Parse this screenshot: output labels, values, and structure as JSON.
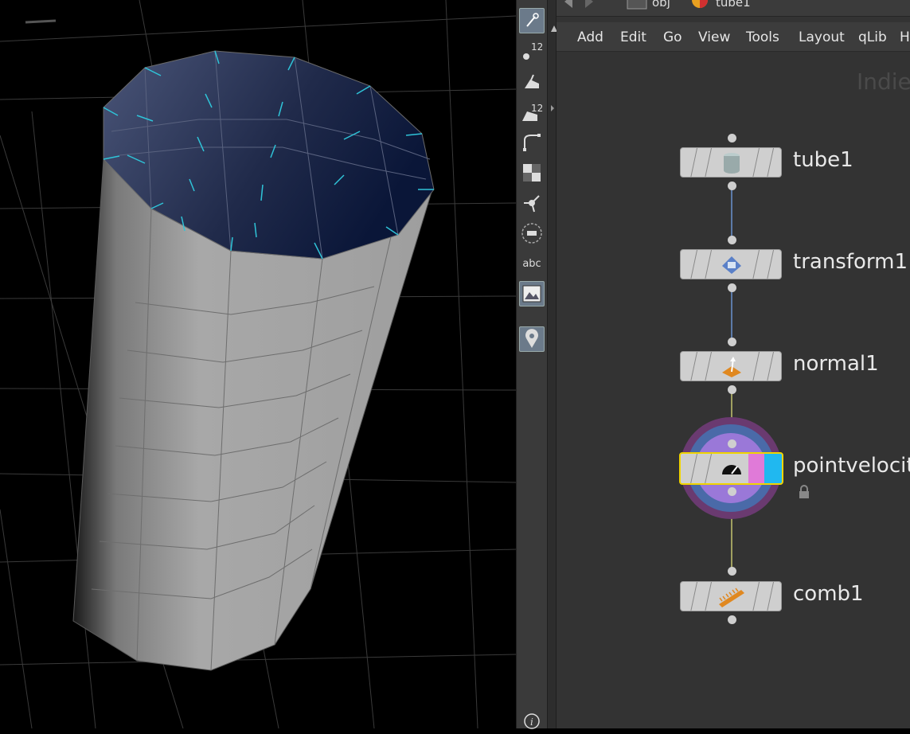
{
  "pathbar": {
    "context": "obj",
    "node": "tube1"
  },
  "menu": [
    "Add",
    "Edit",
    "Go",
    "View",
    "Tools",
    "Layout",
    "qLib",
    "H"
  ],
  "watermark": "Indie",
  "toolbar": {
    "items": [
      "select-tool",
      "point-count-tool",
      "paint-tool",
      "stamp-count-tool",
      "curve-tool",
      "checker-tool",
      "pivot-tool",
      "circle-tool",
      "text-tool",
      "image-tool",
      "pin-tool",
      "info-tool"
    ],
    "count_a": "12",
    "count_b": "12",
    "text_label": "abc"
  },
  "nodes": [
    {
      "name": "tube1",
      "icon": "tube-icon"
    },
    {
      "name": "transform1",
      "icon": "transform-icon"
    },
    {
      "name": "normal1",
      "icon": "normal-icon"
    },
    {
      "name": "pointvelocit",
      "icon": "speedometer-icon",
      "selected": true,
      "locked": true
    },
    {
      "name": "comb1",
      "icon": "comb-icon"
    }
  ],
  "colors": {
    "selected_outline": "#f0d400",
    "display_flag": "#e07ad8",
    "render_flag": "#20b8f0",
    "wire": "#5c7aa8",
    "wire_yellow": "#a0a060"
  }
}
